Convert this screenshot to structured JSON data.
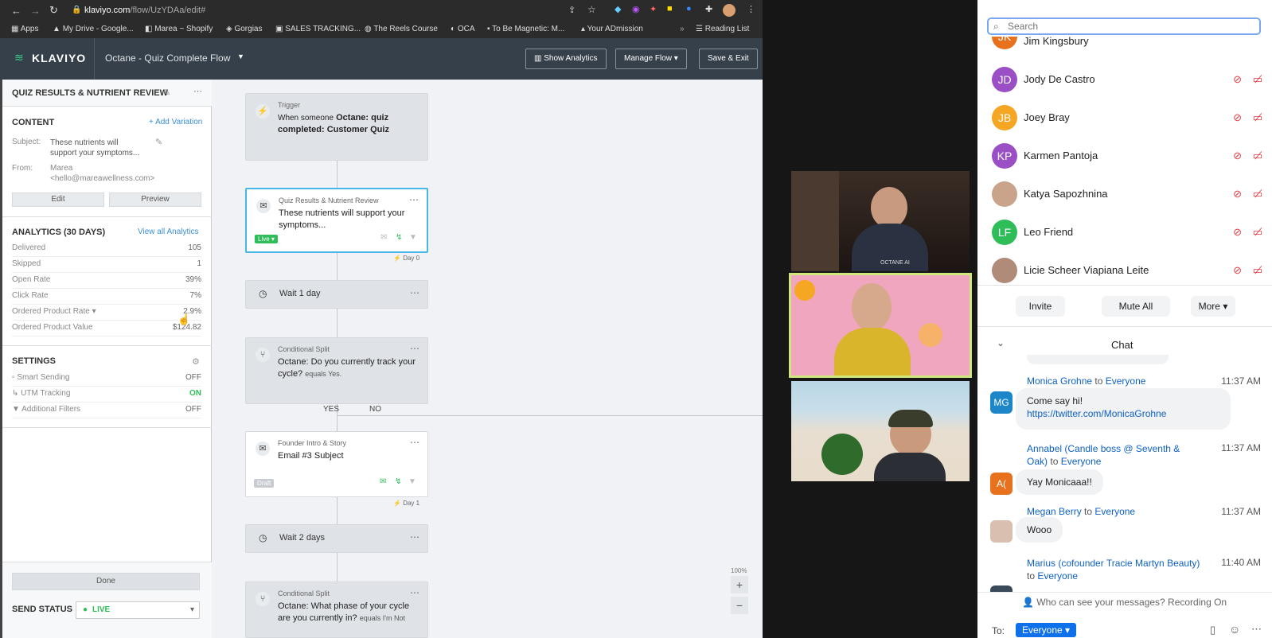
{
  "browser": {
    "url_host": "klaviyo.com",
    "url_path": "/flow/UzYDAa/edit#",
    "bookmarks": [
      "Apps",
      "My Drive - Google...",
      "Marea ~ Shopify",
      "Gorgias",
      "SALES TRACKING...",
      "The Reels Course",
      "OCA",
      "To Be Magnetic: M...",
      "Your ADmission",
      "Reading List"
    ]
  },
  "header": {
    "logo": "KLAVIYO",
    "flow_name": "Octane - Quiz Complete Flow",
    "show_analytics": "Show Analytics",
    "manage_flow": "Manage Flow",
    "save_exit": "Save & Exit"
  },
  "panel": {
    "title": "QUIZ RESULTS & NUTRIENT REVIEW",
    "content_label": "CONTENT",
    "add_variation": "+ Add Variation",
    "subject_label": "Subject:",
    "subject_value": "These nutrients will support your symptoms...",
    "from_label": "From:",
    "from_name": "Marea",
    "from_email": "<hello@mareawellness.com>",
    "edit": "Edit",
    "preview": "Preview",
    "analytics_label": "ANALYTICS (30 DAYS)",
    "view_all": "View all Analytics",
    "stats": [
      {
        "k": "Delivered",
        "v": "105"
      },
      {
        "k": "Skipped",
        "v": "1"
      },
      {
        "k": "Open Rate",
        "v": "39%"
      },
      {
        "k": "Click Rate",
        "v": "7%"
      },
      {
        "k": "Ordered Product Rate",
        "v": "2.9%"
      },
      {
        "k": "Ordered Product Value",
        "v": "$124.82"
      }
    ],
    "settings_label": "SETTINGS",
    "settings": [
      {
        "k": "Smart Sending",
        "v": "OFF"
      },
      {
        "k": "UTM Tracking",
        "v": "ON"
      },
      {
        "k": "Additional Filters",
        "v": "OFF"
      }
    ],
    "done": "Done",
    "send_status_label": "SEND STATUS",
    "send_status": "LIVE"
  },
  "flow": {
    "trigger_label": "Trigger",
    "trigger_text": "When someone",
    "trigger_bold": "Octane: quiz completed: Customer Quiz",
    "email1_label": "Quiz Results & Nutrient Review",
    "email1_text": "These nutrients will support your symptoms...",
    "email1_badge": "Live",
    "day0": "Day 0",
    "wait1": "Wait 1 day",
    "split1_label": "Conditional Split",
    "split1_text": "Octane: Do you currently track your cycle?",
    "split1_suffix": "equals Yes.",
    "yes": "YES",
    "no": "NO",
    "email2_label": "Founder Intro & Story",
    "email2_text": "Email #3 Subject",
    "email2_badge": "Draft",
    "day1": "Day 1",
    "wait2": "Wait 2 days",
    "split2_label": "Conditional Split",
    "split2_text": "Octane: What phase of your cycle are you currently in?",
    "split2_suffix": "equals I'm Not",
    "zoom": "100%",
    "plus": "+",
    "minus": "−"
  },
  "video": {
    "tile1_caption": "OCTANE AI"
  },
  "zoom": {
    "search_placeholder": "Search",
    "participants": [
      {
        "initials": "JK",
        "name": "Jim Kingsbury",
        "color": "#e8711d"
      },
      {
        "initials": "JD",
        "name": "Jody De Castro",
        "color": "#9b4fc4"
      },
      {
        "initials": "JB",
        "name": "Joey Bray",
        "color": "#f5a623"
      },
      {
        "initials": "KP",
        "name": "Karmen Pantoja",
        "color": "#9b4fc4"
      },
      {
        "initials": "",
        "name": "Katya Sapozhnina",
        "color": "#c9a48a"
      },
      {
        "initials": "LF",
        "name": "Leo Friend",
        "color": "#2ebd59"
      },
      {
        "initials": "",
        "name": "Licie Scheer Viapiana Leite",
        "color": "#b08b7a"
      }
    ],
    "invite": "Invite",
    "mute_all": "Mute All",
    "more": "More",
    "chat_title": "Chat",
    "messages": [
      {
        "from": "Monica Grohne",
        "to": "Everyone",
        "time": "11:37 AM",
        "text": "Come say hi! ",
        "link": "https://twitter.com/MonicaGrohne",
        "initials": "MG",
        "color": "#1c86c8"
      },
      {
        "from": "Annabel (Candle boss @ Seventh & Oak)",
        "to": "Everyone",
        "time": "11:37 AM",
        "text": "Yay Monicaaa!!",
        "initials": "A(",
        "color": "#e8711d"
      },
      {
        "from": "Megan Berry",
        "to": "Everyone",
        "time": "11:37 AM",
        "text": "Wooo",
        "initials": "",
        "color": "#caa"
      },
      {
        "from": "Marius (cofounder Tracie Martyn Beauty)",
        "to": "Everyone",
        "time": "11:40 AM",
        "text": "",
        "initials": "",
        "color": "#3a4a5a"
      }
    ],
    "to_word": "to",
    "visibility": "Who can see your messages? Recording On",
    "to_label": "To:",
    "to_value": "Everyone"
  }
}
